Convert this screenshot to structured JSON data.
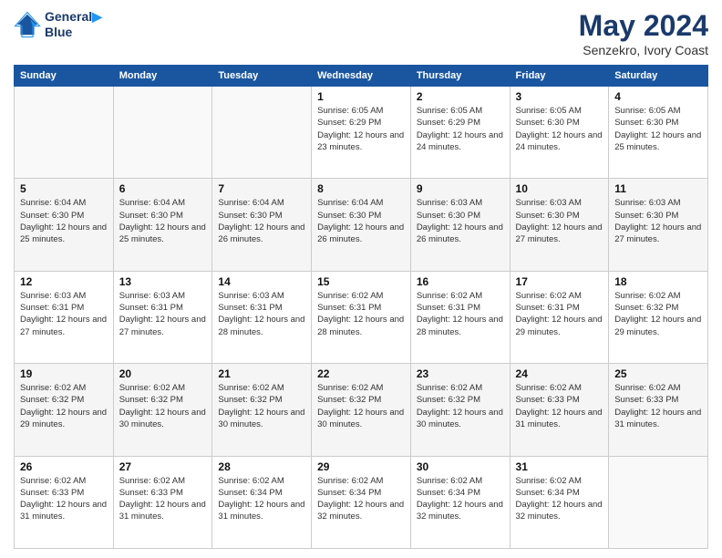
{
  "header": {
    "logo_line1": "General",
    "logo_line2": "Blue",
    "month": "May 2024",
    "location": "Senzekro, Ivory Coast"
  },
  "days_of_week": [
    "Sunday",
    "Monday",
    "Tuesday",
    "Wednesday",
    "Thursday",
    "Friday",
    "Saturday"
  ],
  "weeks": [
    [
      {
        "day": "",
        "info": ""
      },
      {
        "day": "",
        "info": ""
      },
      {
        "day": "",
        "info": ""
      },
      {
        "day": "1",
        "sunrise": "6:05 AM",
        "sunset": "6:29 PM",
        "daylight": "12 hours and 23 minutes."
      },
      {
        "day": "2",
        "sunrise": "6:05 AM",
        "sunset": "6:29 PM",
        "daylight": "12 hours and 24 minutes."
      },
      {
        "day": "3",
        "sunrise": "6:05 AM",
        "sunset": "6:30 PM",
        "daylight": "12 hours and 24 minutes."
      },
      {
        "day": "4",
        "sunrise": "6:05 AM",
        "sunset": "6:30 PM",
        "daylight": "12 hours and 25 minutes."
      }
    ],
    [
      {
        "day": "5",
        "sunrise": "6:04 AM",
        "sunset": "6:30 PM",
        "daylight": "12 hours and 25 minutes."
      },
      {
        "day": "6",
        "sunrise": "6:04 AM",
        "sunset": "6:30 PM",
        "daylight": "12 hours and 25 minutes."
      },
      {
        "day": "7",
        "sunrise": "6:04 AM",
        "sunset": "6:30 PM",
        "daylight": "12 hours and 26 minutes."
      },
      {
        "day": "8",
        "sunrise": "6:04 AM",
        "sunset": "6:30 PM",
        "daylight": "12 hours and 26 minutes."
      },
      {
        "day": "9",
        "sunrise": "6:03 AM",
        "sunset": "6:30 PM",
        "daylight": "12 hours and 26 minutes."
      },
      {
        "day": "10",
        "sunrise": "6:03 AM",
        "sunset": "6:30 PM",
        "daylight": "12 hours and 27 minutes."
      },
      {
        "day": "11",
        "sunrise": "6:03 AM",
        "sunset": "6:30 PM",
        "daylight": "12 hours and 27 minutes."
      }
    ],
    [
      {
        "day": "12",
        "sunrise": "6:03 AM",
        "sunset": "6:31 PM",
        "daylight": "12 hours and 27 minutes."
      },
      {
        "day": "13",
        "sunrise": "6:03 AM",
        "sunset": "6:31 PM",
        "daylight": "12 hours and 27 minutes."
      },
      {
        "day": "14",
        "sunrise": "6:03 AM",
        "sunset": "6:31 PM",
        "daylight": "12 hours and 28 minutes."
      },
      {
        "day": "15",
        "sunrise": "6:02 AM",
        "sunset": "6:31 PM",
        "daylight": "12 hours and 28 minutes."
      },
      {
        "day": "16",
        "sunrise": "6:02 AM",
        "sunset": "6:31 PM",
        "daylight": "12 hours and 28 minutes."
      },
      {
        "day": "17",
        "sunrise": "6:02 AM",
        "sunset": "6:31 PM",
        "daylight": "12 hours and 29 minutes."
      },
      {
        "day": "18",
        "sunrise": "6:02 AM",
        "sunset": "6:32 PM",
        "daylight": "12 hours and 29 minutes."
      }
    ],
    [
      {
        "day": "19",
        "sunrise": "6:02 AM",
        "sunset": "6:32 PM",
        "daylight": "12 hours and 29 minutes."
      },
      {
        "day": "20",
        "sunrise": "6:02 AM",
        "sunset": "6:32 PM",
        "daylight": "12 hours and 30 minutes."
      },
      {
        "day": "21",
        "sunrise": "6:02 AM",
        "sunset": "6:32 PM",
        "daylight": "12 hours and 30 minutes."
      },
      {
        "day": "22",
        "sunrise": "6:02 AM",
        "sunset": "6:32 PM",
        "daylight": "12 hours and 30 minutes."
      },
      {
        "day": "23",
        "sunrise": "6:02 AM",
        "sunset": "6:32 PM",
        "daylight": "12 hours and 30 minutes."
      },
      {
        "day": "24",
        "sunrise": "6:02 AM",
        "sunset": "6:33 PM",
        "daylight": "12 hours and 31 minutes."
      },
      {
        "day": "25",
        "sunrise": "6:02 AM",
        "sunset": "6:33 PM",
        "daylight": "12 hours and 31 minutes."
      }
    ],
    [
      {
        "day": "26",
        "sunrise": "6:02 AM",
        "sunset": "6:33 PM",
        "daylight": "12 hours and 31 minutes."
      },
      {
        "day": "27",
        "sunrise": "6:02 AM",
        "sunset": "6:33 PM",
        "daylight": "12 hours and 31 minutes."
      },
      {
        "day": "28",
        "sunrise": "6:02 AM",
        "sunset": "6:34 PM",
        "daylight": "12 hours and 31 minutes."
      },
      {
        "day": "29",
        "sunrise": "6:02 AM",
        "sunset": "6:34 PM",
        "daylight": "12 hours and 32 minutes."
      },
      {
        "day": "30",
        "sunrise": "6:02 AM",
        "sunset": "6:34 PM",
        "daylight": "12 hours and 32 minutes."
      },
      {
        "day": "31",
        "sunrise": "6:02 AM",
        "sunset": "6:34 PM",
        "daylight": "12 hours and 32 minutes."
      },
      {
        "day": "",
        "info": ""
      }
    ]
  ]
}
